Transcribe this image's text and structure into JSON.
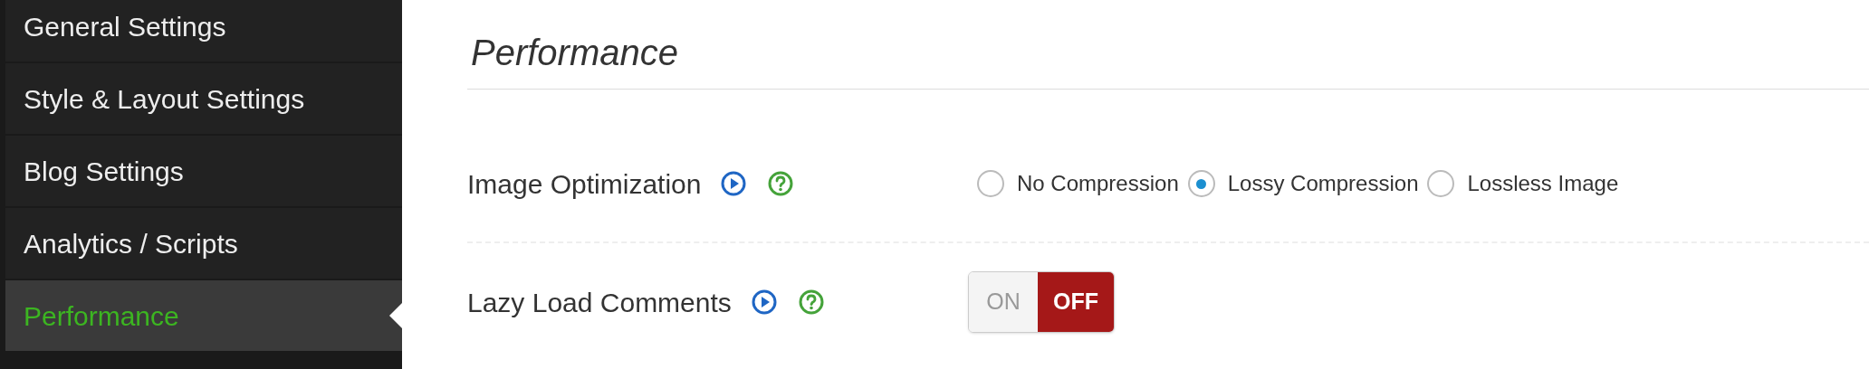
{
  "sidebar": {
    "items": [
      {
        "label": "General Settings",
        "selected": false
      },
      {
        "label": "Style & Layout Settings",
        "selected": false
      },
      {
        "label": "Blog Settings",
        "selected": false
      },
      {
        "label": "Analytics / Scripts",
        "selected": false
      },
      {
        "label": "Performance",
        "selected": true
      }
    ]
  },
  "section_title": "Performance",
  "settings": [
    {
      "kind": "radio",
      "label": "Image Optimization",
      "options": [
        {
          "label": "No Compression",
          "selected": false
        },
        {
          "label": "Lossy Compression",
          "selected": true
        },
        {
          "label": "Lossless Image",
          "selected": false
        }
      ]
    },
    {
      "kind": "toggle",
      "label": "Lazy Load Comments",
      "on_label": "ON",
      "off_label": "OFF",
      "on": false
    }
  ]
}
